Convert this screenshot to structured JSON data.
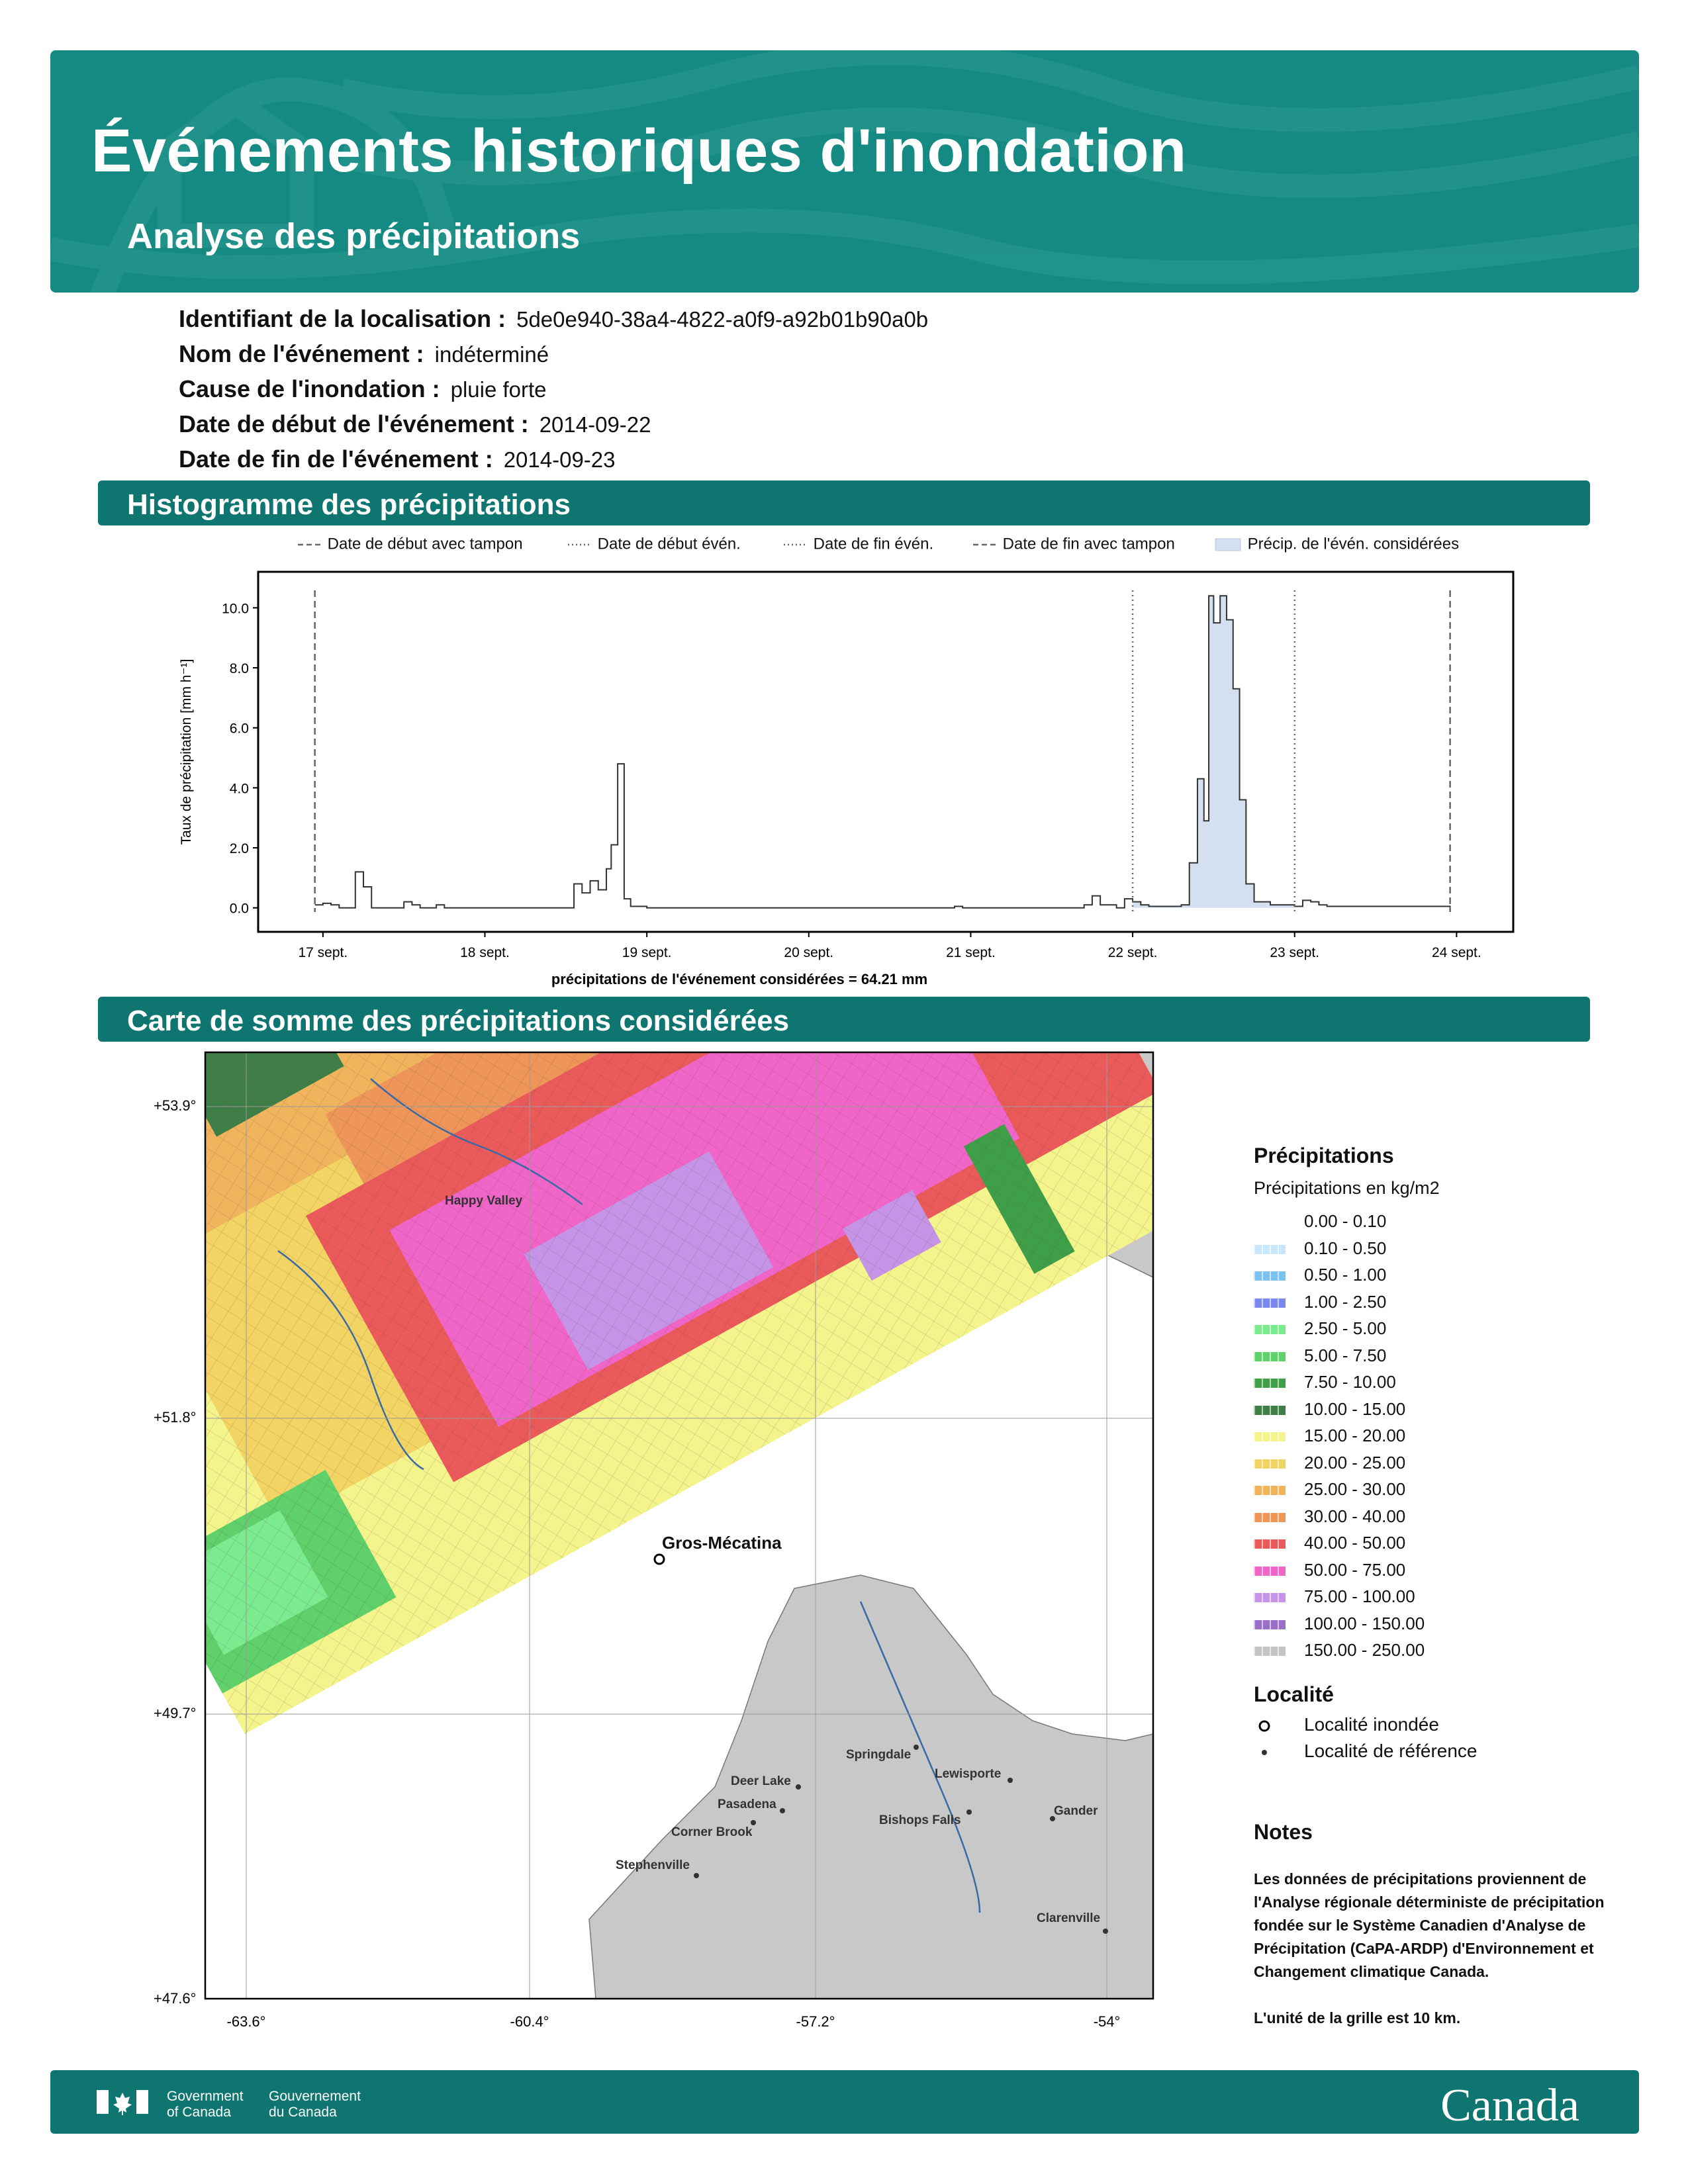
{
  "header": {
    "title": "Événements historiques d'inondation",
    "subtitle": "Analyse des précipitations"
  },
  "event": [
    {
      "label": "Identifiant de la localisation :",
      "value": "5de0e940-38a4-4822-a0f9-a92b01b90a0b"
    },
    {
      "label": "Nom de l'événement :",
      "value": "indéterminé"
    },
    {
      "label": "Cause de l'inondation :",
      "value": "pluie forte"
    },
    {
      "label": "Date de début de l'événement :",
      "value": "2014-09-22"
    },
    {
      "label": "Date de fin de l'événement :",
      "value": "2014-09-23"
    }
  ],
  "sections": {
    "histogram": "Histogramme des précipitations",
    "map": "Carte de somme des précipitations considérées"
  },
  "chart_data": {
    "type": "bar",
    "ylabel": "Taux de précipitation [mm h⁻¹]",
    "x_ticks": [
      "17 sept.",
      "18 sept.",
      "19 sept.",
      "20 sept.",
      "21 sept.",
      "22 sept.",
      "23 sept.",
      "24 sept."
    ],
    "y_ticks": [
      "0.0",
      "2.0",
      "4.0",
      "6.0",
      "8.0",
      "10.0"
    ],
    "ylim": [
      -0.8,
      11.2
    ],
    "xlim": [
      16.6,
      24.35
    ],
    "legend": [
      {
        "label": "Date de début avec tampon",
        "style": "dashed"
      },
      {
        "label": "Date de début événement",
        "style": "dotted"
      },
      {
        "label": "Date de fin événement",
        "style": "dotted"
      },
      {
        "label": "Date de fin avec tampon",
        "style": "dashed"
      },
      {
        "label": "Précip. de l'événement considérées",
        "style": "fill"
      }
    ],
    "legend_display": [
      "Date de début avec tampon",
      "Date de début évén.",
      "Date de fin évén.",
      "Date de fin avec tampon",
      "Précip. de l'évén. considérées"
    ],
    "vlines": [
      {
        "x": 16.95,
        "style": "dashed"
      },
      {
        "x": 22.0,
        "style": "dotted"
      },
      {
        "x": 23.0,
        "style": "dotted"
      },
      {
        "x": 23.96,
        "style": "dashed"
      }
    ],
    "shaded_range": [
      22.0,
      23.0
    ],
    "summary": "précipitations de l'événement considérées = 64.21 mm",
    "series": [
      {
        "points": [
          [
            16.95,
            0.1
          ],
          [
            17.0,
            0.15
          ],
          [
            17.05,
            0.1
          ],
          [
            17.1,
            0.0
          ],
          [
            17.15,
            0.0
          ],
          [
            17.2,
            1.2
          ],
          [
            17.25,
            0.7
          ],
          [
            17.3,
            0.0
          ],
          [
            17.4,
            0.0
          ],
          [
            17.5,
            0.2
          ],
          [
            17.55,
            0.1
          ],
          [
            17.6,
            0.0
          ],
          [
            17.7,
            0.1
          ],
          [
            17.75,
            0.0
          ],
          [
            18.5,
            0.0
          ],
          [
            18.55,
            0.8
          ],
          [
            18.6,
            0.5
          ],
          [
            18.65,
            0.9
          ],
          [
            18.7,
            0.6
          ],
          [
            18.75,
            1.3
          ],
          [
            18.78,
            2.1
          ],
          [
            18.82,
            4.8
          ],
          [
            18.86,
            0.3
          ],
          [
            18.9,
            0.05
          ],
          [
            19.0,
            0.0
          ],
          [
            20.8,
            0.0
          ],
          [
            20.9,
            0.05
          ],
          [
            20.95,
            0.0
          ],
          [
            21.6,
            0.0
          ],
          [
            21.7,
            0.1
          ],
          [
            21.75,
            0.4
          ],
          [
            21.8,
            0.1
          ],
          [
            21.9,
            0.0
          ],
          [
            21.95,
            0.3
          ],
          [
            22.0,
            0.2
          ],
          [
            22.05,
            0.1
          ],
          [
            22.1,
            0.05
          ],
          [
            22.3,
            0.1
          ],
          [
            22.35,
            1.5
          ],
          [
            22.4,
            4.3
          ],
          [
            22.44,
            2.9
          ],
          [
            22.47,
            10.4
          ],
          [
            22.5,
            9.5
          ],
          [
            22.54,
            10.4
          ],
          [
            22.58,
            9.6
          ],
          [
            22.62,
            7.3
          ],
          [
            22.66,
            3.6
          ],
          [
            22.7,
            0.8
          ],
          [
            22.75,
            0.2
          ],
          [
            22.85,
            0.1
          ],
          [
            23.0,
            0.05
          ],
          [
            23.05,
            0.25
          ],
          [
            23.1,
            0.2
          ],
          [
            23.15,
            0.1
          ],
          [
            23.2,
            0.05
          ],
          [
            23.96,
            0.0
          ]
        ]
      }
    ]
  },
  "map": {
    "lat_labels": [
      "+53.9°",
      "+51.8°",
      "+49.7°",
      "+47.6°"
    ],
    "lon_labels": [
      "-63.6°",
      "-60.4°",
      "-57.2°",
      "-54°"
    ],
    "places": [
      {
        "name": "Happy Valley",
        "flooded": false,
        "label_only": true
      },
      {
        "name": "Gros-Mécatina",
        "flooded": true
      },
      {
        "name": "Springdale",
        "flooded": false
      },
      {
        "name": "Lewisporte",
        "flooded": false
      },
      {
        "name": "Deer Lake",
        "flooded": false
      },
      {
        "name": "Pasadena",
        "flooded": false
      },
      {
        "name": "Bishops Falls",
        "flooded": false
      },
      {
        "name": "Gander",
        "flooded": false
      },
      {
        "name": "Corner Brook",
        "flooded": false
      },
      {
        "name": "Stephenville",
        "flooded": false
      },
      {
        "name": "Clarenville",
        "flooded": false
      }
    ]
  },
  "legend": {
    "title": "Précipitations",
    "subtitle": "Précipitations en kg/m2",
    "bins": [
      {
        "label": "0.00 - 0.10",
        "color": "#ffffff"
      },
      {
        "label": "0.10 - 0.50",
        "color": "#c9e6fb"
      },
      {
        "label": "0.50 - 1.00",
        "color": "#7cc0f4"
      },
      {
        "label": "1.00 - 2.50",
        "color": "#7b89ee"
      },
      {
        "label": "2.50 - 5.00",
        "color": "#7ceb8f"
      },
      {
        "label": "5.00 - 7.50",
        "color": "#5fd06a"
      },
      {
        "label": "7.50 - 10.00",
        "color": "#3f9f48"
      },
      {
        "label": "10.00 - 15.00",
        "color": "#3f7f47"
      },
      {
        "label": "15.00 - 20.00",
        "color": "#f4f48c"
      },
      {
        "label": "20.00 - 25.00",
        "color": "#f1d463"
      },
      {
        "label": "25.00 - 30.00",
        "color": "#f0b55c"
      },
      {
        "label": "30.00 - 40.00",
        "color": "#ee9659"
      },
      {
        "label": "40.00 - 50.00",
        "color": "#ea5a5a"
      },
      {
        "label": "50.00 - 75.00",
        "color": "#f065c8"
      },
      {
        "label": "75.00 - 100.00",
        "color": "#c594e6"
      },
      {
        "label": "100.00 - 150.00",
        "color": "#9a6fc6"
      },
      {
        "label": "150.00 - 250.00",
        "color": "#c4c4c4"
      }
    ],
    "locality_title": "Localité",
    "flooded_label": "Localité inondée",
    "reference_label": "Localité de référence"
  },
  "notes": {
    "title": "Notes",
    "text": "Les données de précipitations proviennent de l'Analyse régionale déterministe de précipitation fondée sur le Système Canadien d'Analyse de Précipitation (CaPA-ARDP) d'Environnement et Changement climatique Canada.",
    "grid": "L'unité de la grille est 10 km."
  },
  "footer": {
    "gov_en_1": "Government",
    "gov_en_2": "of Canada",
    "gov_fr_1": "Gouvernement",
    "gov_fr_2": "du Canada",
    "wordmark": "Canada"
  }
}
